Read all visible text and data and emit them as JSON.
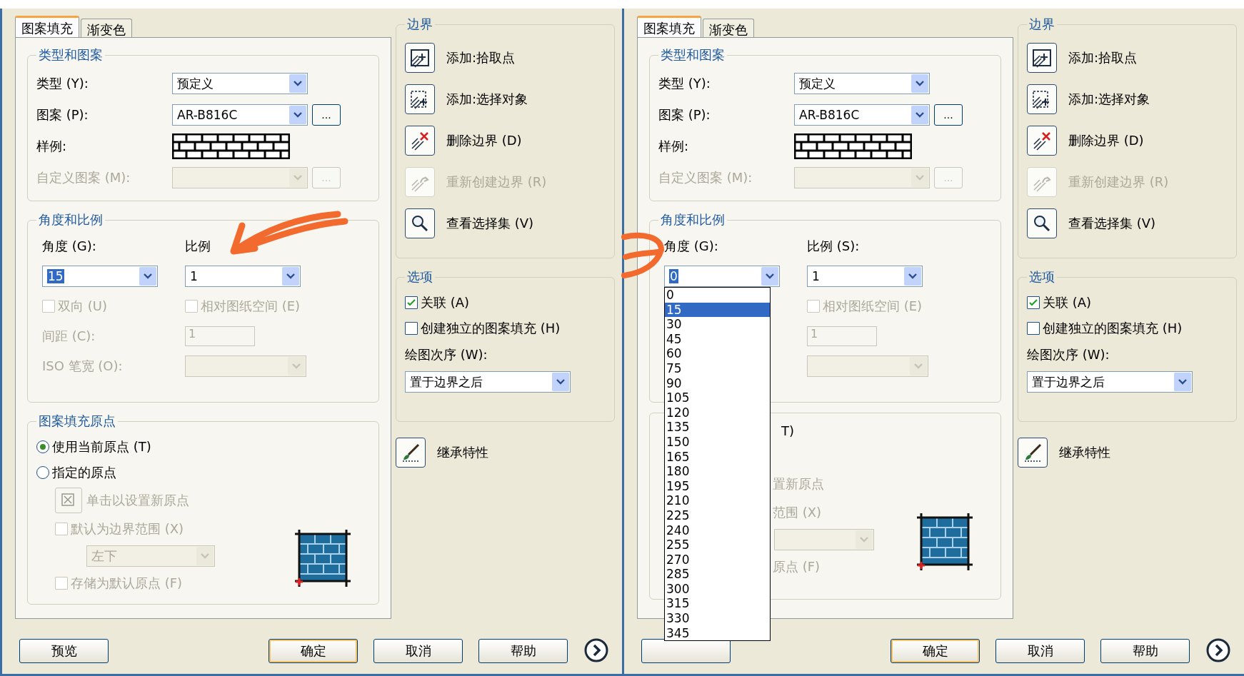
{
  "panels": [
    {
      "tabs": [
        {
          "label": "图案填充",
          "selected": true
        },
        {
          "label": "渐变色",
          "selected": false
        }
      ],
      "type_group": {
        "title": "类型和图案",
        "type_label": "类型 (Y):",
        "type_value": "预定义",
        "pattern_label": "图案 (P):",
        "pattern_value": "AR-B816C",
        "pattern_button": "...",
        "sample_label": "样例:",
        "custom_label": "自定义图案 (M):",
        "custom_button": "..."
      },
      "angle_group": {
        "title": "角度和比例",
        "angle_label": "角度 (G):",
        "angle_value": "15",
        "value_selected": true,
        "scale_label": "比例",
        "scale_value": "1",
        "bidirectional": {
          "label": "双向 (U)",
          "checked": false
        },
        "paper_space": {
          "label": "相对图纸空间 (E)",
          "checked": false
        },
        "spacing_label": "间距 (C):",
        "spacing_value": "1",
        "iso_label": "ISO 笔宽 (O):"
      },
      "origin_group": {
        "title": "图案填充原点",
        "options": [
          {
            "label": "使用当前原点 (T)",
            "selected": true
          },
          {
            "label": "指定的原点",
            "selected": false
          }
        ],
        "click_label": "单击以设置新原点",
        "default_extent": {
          "label": "默认为边界范围 (X)",
          "checked": false
        },
        "position_value": "左下",
        "store_default": {
          "label": "存储为默认原点 (F)",
          "checked": false
        }
      },
      "boundary_group": {
        "title": "边界",
        "actions": [
          {
            "label": "添加:拾取点",
            "kind": "pick",
            "disabled": false
          },
          {
            "label": "添加:选择对象",
            "kind": "select",
            "disabled": false
          },
          {
            "label": "删除边界 (D)",
            "kind": "remove",
            "disabled": false
          },
          {
            "label": "重新创建边界 (R)",
            "kind": "recreate",
            "disabled": true
          },
          {
            "label": "查看选择集 (V)",
            "kind": "view",
            "disabled": false
          }
        ]
      },
      "options_group": {
        "title": "选项",
        "checks": [
          {
            "label": "关联 (A)",
            "checked": true
          },
          {
            "label": "创建独立的图案填充 (H)",
            "checked": false
          }
        ],
        "draw_order_label": "绘图次序 (W):",
        "draw_order_value": "置于边界之后"
      },
      "inherit_label": "继承特性",
      "buttons": [
        {
          "label": "预览",
          "kind": "preview"
        },
        {
          "label": "确定",
          "kind": "default"
        },
        {
          "label": "取消",
          "kind": "normal"
        },
        {
          "label": "帮助",
          "kind": "normal"
        }
      ]
    },
    {
      "tabs": [
        {
          "label": "图案填充",
          "selected": true
        },
        {
          "label": "渐变色",
          "selected": false
        }
      ],
      "type_group": {
        "title": "类型和图案",
        "type_label": "类型 (Y):",
        "type_value": "预定义",
        "pattern_label": "图案 (P):",
        "pattern_value": "AR-B816C",
        "pattern_button": "...",
        "sample_label": "样例:",
        "custom_label": "自定义图案 (M):",
        "custom_button": "..."
      },
      "angle_group": {
        "title": "角度和比例",
        "angle_label": "角度 (G):",
        "angle_value": "0",
        "value_selected": true,
        "scale_label": "比例 (S):",
        "scale_value": "1",
        "paper_space": {
          "label": "相对图纸空间 (E)",
          "checked": false
        },
        "spacing_value": "1",
        "angle_list": [
          {
            "label": "0",
            "selected": false
          },
          {
            "label": "15",
            "selected": true
          },
          {
            "label": "30",
            "selected": false
          },
          {
            "label": "45",
            "selected": false
          },
          {
            "label": "60",
            "selected": false
          },
          {
            "label": "75",
            "selected": false
          },
          {
            "label": "90",
            "selected": false
          },
          {
            "label": "105",
            "selected": false
          },
          {
            "label": "120",
            "selected": false
          },
          {
            "label": "135",
            "selected": false
          },
          {
            "label": "150",
            "selected": false
          },
          {
            "label": "165",
            "selected": false
          },
          {
            "label": "180",
            "selected": false
          },
          {
            "label": "195",
            "selected": false
          },
          {
            "label": "210",
            "selected": false
          },
          {
            "label": "225",
            "selected": false
          },
          {
            "label": "240",
            "selected": false
          },
          {
            "label": "255",
            "selected": false
          },
          {
            "label": "270",
            "selected": false
          },
          {
            "label": "285",
            "selected": false
          },
          {
            "label": "300",
            "selected": false
          },
          {
            "label": "315",
            "selected": false
          },
          {
            "label": "330",
            "selected": false
          },
          {
            "label": "345",
            "selected": false
          }
        ]
      },
      "origin_group": {
        "options": [
          {
            "label": "T)"
          }
        ],
        "click_label": "置新原点",
        "default_extent": {
          "label": "范围 (X)"
        },
        "store_default": {
          "label": "原点 (F)"
        }
      },
      "boundary_group": {
        "title": "边界",
        "actions": [
          {
            "label": "添加:拾取点",
            "kind": "pick",
            "disabled": false
          },
          {
            "label": "添加:选择对象",
            "kind": "select",
            "disabled": false
          },
          {
            "label": "删除边界 (D)",
            "kind": "remove",
            "disabled": false
          },
          {
            "label": "重新创建边界 (R)",
            "kind": "recreate",
            "disabled": true
          },
          {
            "label": "查看选择集 (V)",
            "kind": "view",
            "disabled": false
          }
        ]
      },
      "options_group": {
        "title": "选项",
        "checks": [
          {
            "label": "关联 (A)",
            "checked": true
          },
          {
            "label": "创建独立的图案填充 (H)",
            "checked": false
          }
        ],
        "draw_order_label": "绘图次序 (W):",
        "draw_order_value": "置于边界之后"
      },
      "inherit_label": "继承特性",
      "buttons": [
        {
          "kind": "preview"
        },
        {
          "label": "确定",
          "kind": "default"
        },
        {
          "label": "取消",
          "kind": "normal"
        },
        {
          "label": "帮助",
          "kind": "normal"
        }
      ]
    }
  ]
}
